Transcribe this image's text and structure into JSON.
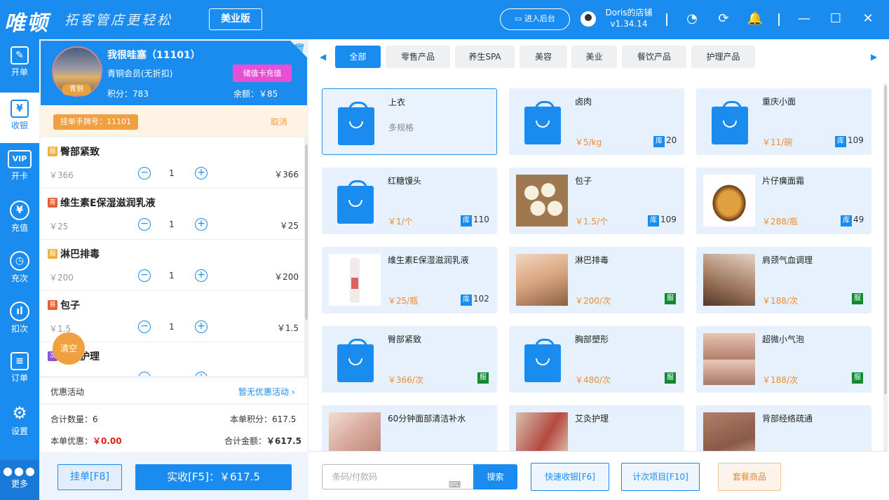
{
  "header": {
    "logo": "唯顿",
    "slogan": "拓客管店更轻松",
    "edition": "美业版",
    "backend_label": "进入后台",
    "shop_name": "Doris的店铺",
    "version": "v1.34.14"
  },
  "sidebar": {
    "items": [
      {
        "label": "开单",
        "icon": "edit-icon"
      },
      {
        "label": "收银",
        "icon": "yen-box-icon"
      },
      {
        "label": "开卡",
        "icon": "vip-card-icon"
      },
      {
        "label": "充值",
        "icon": "yen-plus-icon"
      },
      {
        "label": "充次",
        "icon": "timer-icon"
      },
      {
        "label": "扣次",
        "icon": "bar-chart-icon"
      },
      {
        "label": "订单",
        "icon": "list-icon"
      },
      {
        "label": "设置",
        "icon": "gear-icon"
      }
    ],
    "more_label": "更多"
  },
  "member": {
    "name": "我很哇塞（11101）",
    "type": "青铜会员(无折扣)",
    "level": "青铜",
    "points": "积分：783",
    "balance": "余额：￥85",
    "recharge_label": "储值卡充值"
  },
  "hold": {
    "tag": "挂单手牌号：11101",
    "cancel": "取消"
  },
  "cart": {
    "items": [
      {
        "tag": "服",
        "name": "臀部紧致",
        "price": "￥366",
        "qty": "1",
        "total": "￥366"
      },
      {
        "tag": "普",
        "name": "维生素E保湿滋润乳液",
        "price": "￥25",
        "qty": "1",
        "total": "￥25"
      },
      {
        "tag": "服",
        "name": "淋巴排毒",
        "price": "￥200",
        "qty": "1",
        "total": "￥200"
      },
      {
        "tag": "普",
        "name": "包子",
        "price": "￥1.5",
        "qty": "1",
        "total": "￥1.5"
      },
      {
        "tag": "次",
        "name": "艾灸护理",
        "price": "",
        "qty": "",
        "total": ""
      }
    ],
    "clear_label": "清空"
  },
  "promo": {
    "label": "优惠活动",
    "value": "暂无优惠活动"
  },
  "summary": {
    "count_label": "合计数量：",
    "count": "6",
    "points_label": "本单积分：",
    "points": "617.5",
    "discount_label": "本单优惠：",
    "discount": "￥0.00",
    "total_label": "合计金额：",
    "total": "￥617.5"
  },
  "actions": {
    "hold": "挂单[F8]",
    "pay": "实收[F5]：￥617.5"
  },
  "tabs": [
    "全部",
    "零售产品",
    "养生SPA",
    "美容",
    "美业",
    "餐饮产品",
    "护理产品"
  ],
  "products": [
    {
      "name": "上衣",
      "sub": "多规格",
      "price": "",
      "stock": "",
      "svc": false,
      "image": "bag-icon",
      "selected": true
    },
    {
      "name": "卤肉",
      "sub": "",
      "price": "￥5/kg",
      "stock": "20",
      "svc": false,
      "image": "bag-icon"
    },
    {
      "name": "重庆小面",
      "sub": "",
      "price": "￥11/碗",
      "stock": "109",
      "svc": false,
      "image": "bag-icon"
    },
    {
      "name": "红糖馒头",
      "sub": "",
      "price": "￥1/个",
      "stock": "110",
      "svc": false,
      "image": "bag-icon"
    },
    {
      "name": "包子",
      "sub": "",
      "price": "￥1.5/个",
      "stock": "109",
      "svc": false,
      "image": "photo-bun"
    },
    {
      "name": "片仔癀面霜",
      "sub": "",
      "price": "￥288/瓶",
      "stock": "49",
      "svc": false,
      "image": "photo-cream"
    },
    {
      "name": "维生素E保湿滋润乳液",
      "sub": "",
      "price": "￥25/瓶",
      "stock": "102",
      "svc": false,
      "image": "photo-bottle"
    },
    {
      "name": "淋巴排毒",
      "sub": "",
      "price": "￥200/次",
      "stock": "",
      "svc": true,
      "image": "photo-spa"
    },
    {
      "name": "肩颈气血调理",
      "sub": "",
      "price": "￥188/次",
      "stock": "",
      "svc": true,
      "image": "photo-spa2"
    },
    {
      "name": "臀部紧致",
      "sub": "",
      "price": "￥366/次",
      "stock": "",
      "svc": true,
      "image": "bag-icon"
    },
    {
      "name": "胸部塑形",
      "sub": "",
      "price": "￥480/次",
      "stock": "",
      "svc": true,
      "image": "bag-icon"
    },
    {
      "name": "超微小气泡",
      "sub": "",
      "price": "￥188/次",
      "stock": "",
      "svc": true,
      "image": "photo-skin"
    },
    {
      "name": "60分钟面部清洁补水",
      "sub": "",
      "price": "",
      "stock": "",
      "svc": false,
      "image": "photo-face"
    },
    {
      "name": "艾灸护理",
      "sub": "",
      "price": "",
      "stock": "",
      "svc": false,
      "image": "photo-moxa"
    },
    {
      "name": "背部经络疏通",
      "sub": "",
      "price": "",
      "stock": "",
      "svc": false,
      "image": "photo-back"
    }
  ],
  "labels": {
    "stock_badge": "库",
    "service_badge": "服"
  },
  "bottom": {
    "barcode_placeholder": "条码/付款码",
    "search": "搜索",
    "quick_pay": "快速收银[F6]",
    "count_item": "计次项目[F10]",
    "package": "套餐商品"
  },
  "colors": {
    "primary": "#1a8cf0",
    "accent_orange": "#f0a040",
    "price_orange": "#f08a30",
    "service_green": "#0f8a30",
    "recharge_pink": "#e84fd5"
  }
}
